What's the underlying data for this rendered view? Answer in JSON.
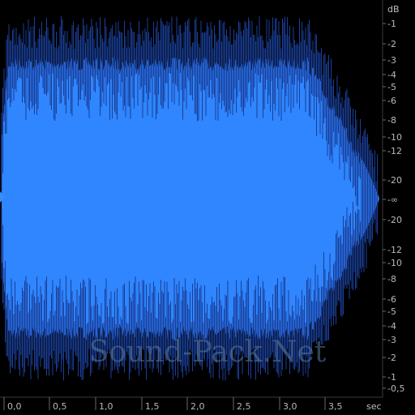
{
  "app": {
    "watermark": "Sound-Pack.Net"
  },
  "colors": {
    "background": "#000000",
    "waveform": "#2f86ff",
    "spikes": "#1a3f9a",
    "axis_text": "#b8b8b8",
    "ruler": "#3a3a3a",
    "marker": "#3a8cff"
  },
  "db_scale": {
    "unit_label": "dB",
    "top_labels": [
      "-1",
      "-2",
      "-3",
      "-4",
      "-5",
      "-6",
      "-8",
      "-10",
      "-12",
      "-20"
    ],
    "center_label": "-∞",
    "bottom_labels": [
      "-20",
      "-12",
      "-10",
      "-8",
      "-6",
      "-5",
      "-4",
      "-3",
      "-2",
      "-1",
      "-0,5"
    ]
  },
  "time_axis": {
    "unit_label": "sec",
    "labels": [
      "0,0",
      "0,5",
      "1,0",
      "1,5",
      "2,0",
      "2,5",
      "3,0",
      "3,5"
    ]
  }
}
